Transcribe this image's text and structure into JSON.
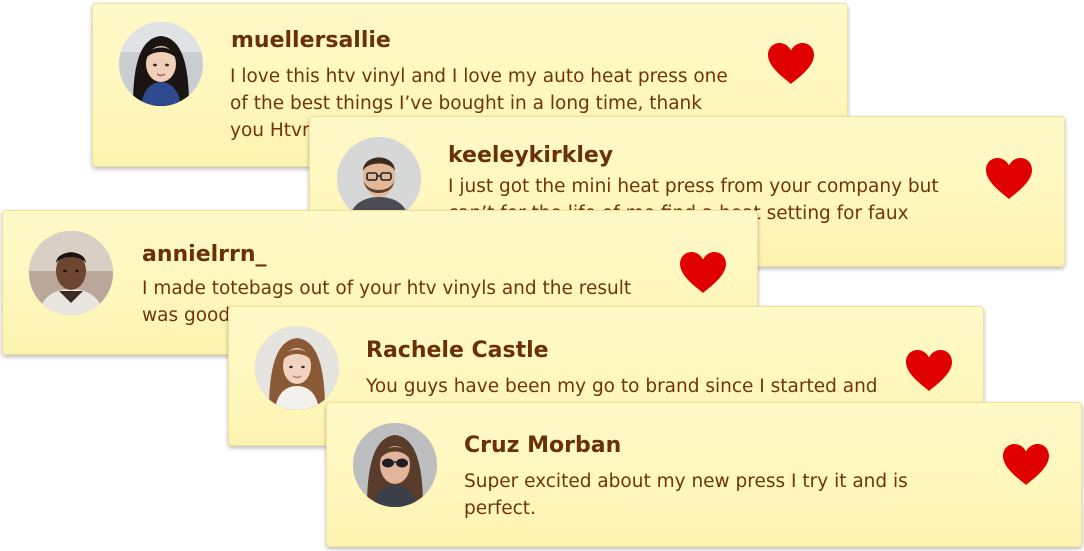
{
  "testimonials": [
    {
      "username": "muellersallie",
      "text": "I love this htv vinyl and I love my auto heat press one of the best things I’ve bought in a long time, thank you Htvront",
      "avatar": "woman-long-black-hair-avatar",
      "icon": "heart-icon"
    },
    {
      "username": "keeleykirkley",
      "text": "I just got the mini heat press from your company but can’t for the life of me find a heat setting for faux leather",
      "avatar": "man-glasses-beard-avatar",
      "icon": "heart-icon"
    },
    {
      "username": "annielrrn_",
      "text": "I made totebags out of your htv vinyls and the result was good",
      "avatar": "man-sweater-avatar",
      "icon": "heart-icon"
    },
    {
      "username": "Rachele Castle",
      "text": "You guys have been my go to brand since I started and",
      "avatar": "woman-light-brown-hair-avatar",
      "icon": "heart-icon"
    },
    {
      "username": "Cruz Morban",
      "text": "Super excited about my new press I try it and is perfect.",
      "avatar": "woman-sunglasses-avatar",
      "icon": "heart-icon"
    }
  ],
  "colors": {
    "card_background": "#fff7bd",
    "name_text": "#6a3008",
    "body_text": "#70340a",
    "heart": "#e00000"
  }
}
